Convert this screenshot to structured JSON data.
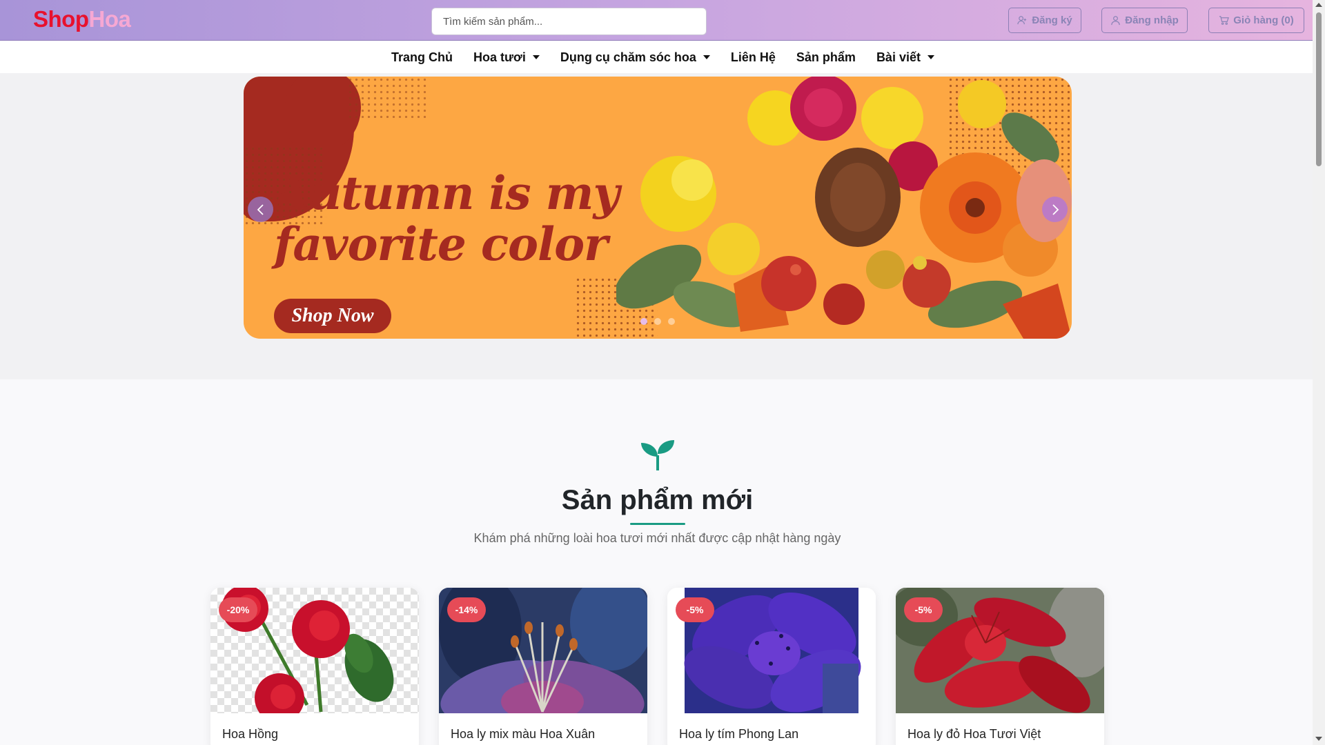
{
  "header": {
    "logo_part1": "Shop",
    "logo_part2": "Hoa",
    "search_placeholder": "Tìm kiếm sản phẩm...",
    "register_label": "Đăng ký",
    "login_label": "Đăng nhập",
    "cart_label": "Giỏ hàng (0)"
  },
  "nav": {
    "items": [
      {
        "label": "Trang Chủ",
        "dropdown": false
      },
      {
        "label": "Hoa tươi",
        "dropdown": true
      },
      {
        "label": "Dụng cụ chăm sóc hoa",
        "dropdown": true
      },
      {
        "label": "Liên Hệ",
        "dropdown": false
      },
      {
        "label": "Sản phẩm",
        "dropdown": false
      },
      {
        "label": "Bài viết",
        "dropdown": true
      }
    ]
  },
  "banner": {
    "title_line1": "Autumn is my",
    "title_line2": "favorite color",
    "cta_label": "Shop Now",
    "slide_count": 3,
    "active_slide": 1
  },
  "section": {
    "icon": "sprout-icon",
    "title": "Sản phẩm mới",
    "subtitle": "Khám phá những loài hoa tươi mới nhất được cập nhật hàng ngày"
  },
  "products": [
    {
      "name": "Hoa Hồng",
      "discount": "-20%"
    },
    {
      "name": "Hoa ly mix màu Hoa Xuân",
      "discount": "-14%"
    },
    {
      "name": "Hoa ly tím Phong Lan",
      "discount": "-5%"
    },
    {
      "name": "Hoa ly đỏ Hoa Tươi Việt",
      "discount": "-5%"
    }
  ],
  "colors": {
    "accent": "#1a9b83",
    "badge": "#e64b57",
    "banner_bg": "#fda743",
    "banner_text": "#a52a20",
    "logo_red": "#e8112d",
    "logo_pink": "#f6a8d3"
  }
}
